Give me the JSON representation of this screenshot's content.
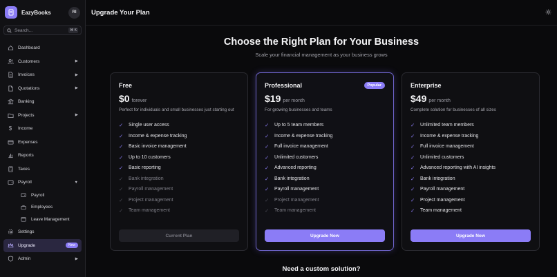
{
  "app": {
    "name": "EazyBooks",
    "user_initials": "RI"
  },
  "search": {
    "placeholder": "Search...",
    "shortcut": "⌘ K"
  },
  "sidebar": {
    "items": [
      {
        "label": "Dashboard",
        "icon": "home-icon"
      },
      {
        "label": "Customers",
        "icon": "users-icon",
        "chevron": "▶"
      },
      {
        "label": "Invoices",
        "icon": "file-icon",
        "chevron": "▶"
      },
      {
        "label": "Quotations",
        "icon": "document-icon",
        "chevron": "▶"
      },
      {
        "label": "Banking",
        "icon": "bank-icon"
      },
      {
        "label": "Projects",
        "icon": "folder-icon",
        "chevron": "▶"
      },
      {
        "label": "Income",
        "icon": "dollar-icon"
      },
      {
        "label": "Expenses",
        "icon": "card-icon"
      },
      {
        "label": "Reports",
        "icon": "chart-icon"
      },
      {
        "label": "Taxes",
        "icon": "calculator-icon"
      },
      {
        "label": "Payroll",
        "icon": "wallet-icon",
        "chevron": "▼"
      },
      {
        "label": "Settings",
        "icon": "gear-icon"
      },
      {
        "label": "Upgrade",
        "icon": "crown-icon",
        "badge": "New"
      },
      {
        "label": "Admin",
        "icon": "shield-icon",
        "chevron": "▶"
      }
    ],
    "payroll_sub": [
      {
        "label": "Payroll",
        "icon": "wallet-icon"
      },
      {
        "label": "Employees",
        "icon": "briefcase-icon"
      },
      {
        "label": "Leave Management",
        "icon": "calendar-icon"
      }
    ]
  },
  "header": {
    "title": "Upgrade Your Plan"
  },
  "hero": {
    "title": "Choose the Right Plan for Your Business",
    "subtitle": "Scale your financial management as your business grows"
  },
  "plans": [
    {
      "name": "Free",
      "price": "$0",
      "period": "forever",
      "description": "Perfect for individuals and small businesses just starting out",
      "features": [
        {
          "text": "Single user access",
          "on": true
        },
        {
          "text": "Income & expense tracking",
          "on": true
        },
        {
          "text": "Basic invoice management",
          "on": true
        },
        {
          "text": "Up to 10 customers",
          "on": true
        },
        {
          "text": "Basic reporting",
          "on": true
        },
        {
          "text": "Bank integration",
          "on": false
        },
        {
          "text": "Payroll management",
          "on": false
        },
        {
          "text": "Project management",
          "on": false
        },
        {
          "text": "Team management",
          "on": false
        }
      ],
      "button": "Current Plan"
    },
    {
      "name": "Professional",
      "price": "$19",
      "period": "per month",
      "badge": "Popular",
      "description": "For growing businesses and teams",
      "features": [
        {
          "text": "Up to 5 team members",
          "on": true
        },
        {
          "text": "Income & expense tracking",
          "on": true
        },
        {
          "text": "Full invoice management",
          "on": true
        },
        {
          "text": "Unlimited customers",
          "on": true
        },
        {
          "text": "Advanced reporting",
          "on": true
        },
        {
          "text": "Bank integration",
          "on": true
        },
        {
          "text": "Payroll management",
          "on": true
        },
        {
          "text": "Project management",
          "on": false
        },
        {
          "text": "Team management",
          "on": false
        }
      ],
      "button": "Upgrade Now"
    },
    {
      "name": "Enterprise",
      "price": "$49",
      "period": "per month",
      "description": "Complete solution for businesses of all sizes",
      "features": [
        {
          "text": "Unlimited team members",
          "on": true
        },
        {
          "text": "Income & expense tracking",
          "on": true
        },
        {
          "text": "Full invoice management",
          "on": true
        },
        {
          "text": "Unlimited customers",
          "on": true
        },
        {
          "text": "Advanced reporting with AI insights",
          "on": true
        },
        {
          "text": "Bank integration",
          "on": true
        },
        {
          "text": "Payroll management",
          "on": true
        },
        {
          "text": "Project management",
          "on": true
        },
        {
          "text": "Team management",
          "on": true
        }
      ],
      "button": "Upgrade Now"
    }
  ],
  "custom": {
    "title": "Need a custom solution?"
  },
  "colors": {
    "accent": "#8b7cf6",
    "background": "#0a0a0c",
    "sidebar": "#111114"
  },
  "icons": {
    "check": "✓",
    "theme": "sun-icon"
  }
}
